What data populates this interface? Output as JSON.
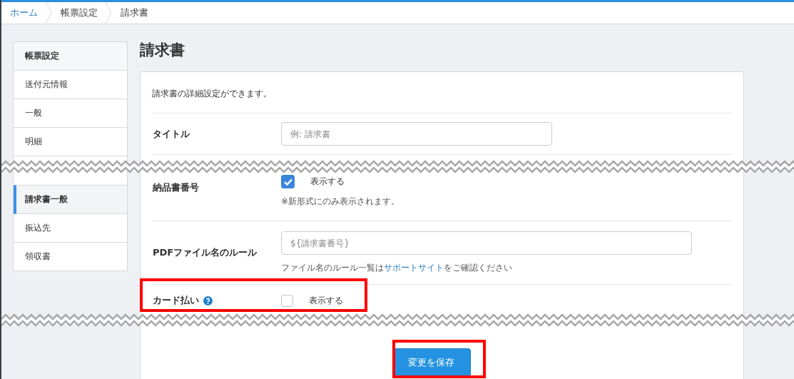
{
  "breadcrumb": [
    {
      "label": "ホーム",
      "link": true
    },
    {
      "label": "帳票設定",
      "link": false
    },
    {
      "label": "請求書",
      "link": false
    }
  ],
  "sidebar": {
    "header": "帳票設定",
    "items": [
      {
        "label": "送付元情報",
        "selected": false
      },
      {
        "label": "一般",
        "selected": false
      },
      {
        "label": "明細",
        "selected": false
      },
      {
        "label": "請求書一般",
        "selected": true
      },
      {
        "label": "振込先",
        "selected": false
      },
      {
        "label": "領収書",
        "selected": false
      }
    ]
  },
  "page_title": "請求書",
  "description": "請求書の詳細設定ができます。",
  "fields": [
    {
      "kind": "text",
      "label": "タイトル",
      "placeholder": "例: 請求書"
    },
    {
      "kind": "checkbox",
      "label": "納品書番号",
      "checked": true,
      "option": "表示する",
      "note": "※新形式にのみ表示されます。"
    },
    {
      "kind": "text",
      "label": "PDFファイル名のルール",
      "placeholder": "${請求書番号}",
      "note_before": "ファイル名のルール一覧は",
      "link": "サポートサイト",
      "note_after": "をご確認ください"
    },
    {
      "kind": "checkbox",
      "label": "カード払い",
      "help": true,
      "checked": false,
      "option": "表示する"
    }
  ],
  "save_button": "変更を保存"
}
